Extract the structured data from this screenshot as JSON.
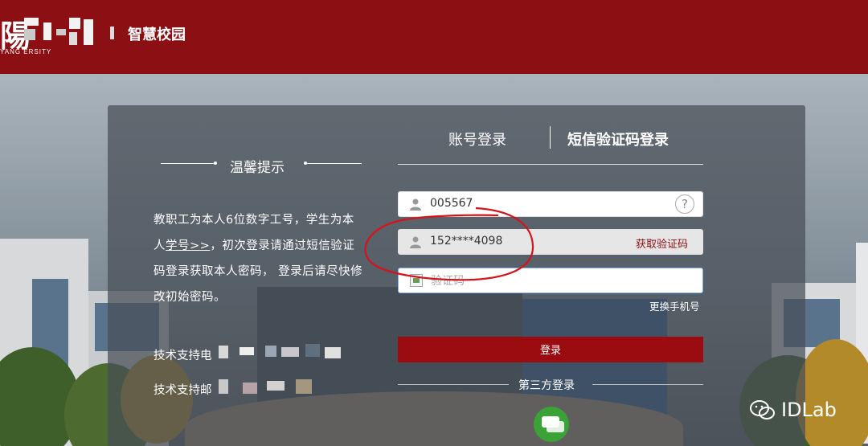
{
  "header": {
    "logo_glyph": "陽",
    "logo_sub": "YANG          ERSITY",
    "site_title": "智慧校园"
  },
  "tips": {
    "title": "温馨提示",
    "text_part1": "教职工为本人6位数字工号，学生为本人",
    "link": "学号>>",
    "text_part2": "，初次登录请通过短信验证码登录获取本人密码， 登录后请尽快修改初始密码。",
    "support_phone_label": "技术支持电",
    "support_email_label": "技术支持邮"
  },
  "login": {
    "tab_account": "账号登录",
    "tab_sms": "短信验证码登录",
    "account_value": "005567",
    "help_icon": "?",
    "phone_value": "152****4098",
    "get_code_label": "获取验证码",
    "captcha_placeholder": "验证码",
    "change_phone_label": "更换手机号",
    "submit_label": "登录",
    "third_party_label": "第三方登录"
  },
  "watermark": {
    "text": "IDLab",
    "icon": "wechat-icon"
  },
  "colors": {
    "brand": "#8b0f13",
    "button": "#9a0c10",
    "annotation": "#d4141b",
    "wechat": "#3aa236"
  }
}
